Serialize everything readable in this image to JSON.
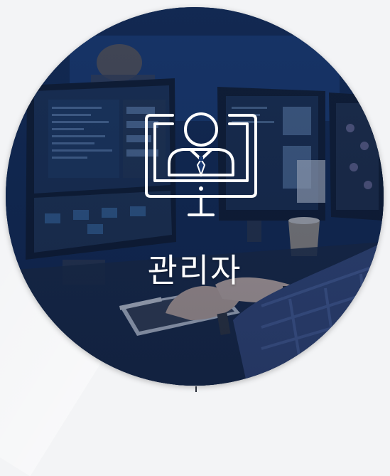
{
  "role_card": {
    "label": "관리자",
    "icon": "admin-monitor-icon",
    "overlay_color": "#1a3a73"
  }
}
